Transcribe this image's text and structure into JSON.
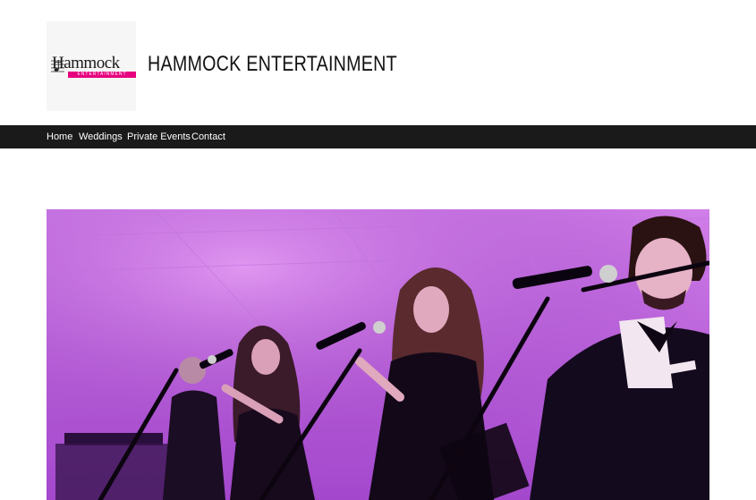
{
  "header": {
    "logo": {
      "wordmark": "Hammock",
      "tagline": "ENTERTAINMENT",
      "icon": "music-staff-icon"
    },
    "site_title": "HAMMOCK ENTERTAINMENT"
  },
  "nav": {
    "items": [
      {
        "label": "Home"
      },
      {
        "label": "Weddings"
      },
      {
        "label": "Private Events"
      },
      {
        "label": "Contact"
      }
    ]
  },
  "hero": {
    "image": "band-performing-on-stage-photo"
  },
  "colors": {
    "nav_bg": "#1a1a1a",
    "brand_pink": "#e6007e",
    "stage_light": "#b548d6"
  }
}
